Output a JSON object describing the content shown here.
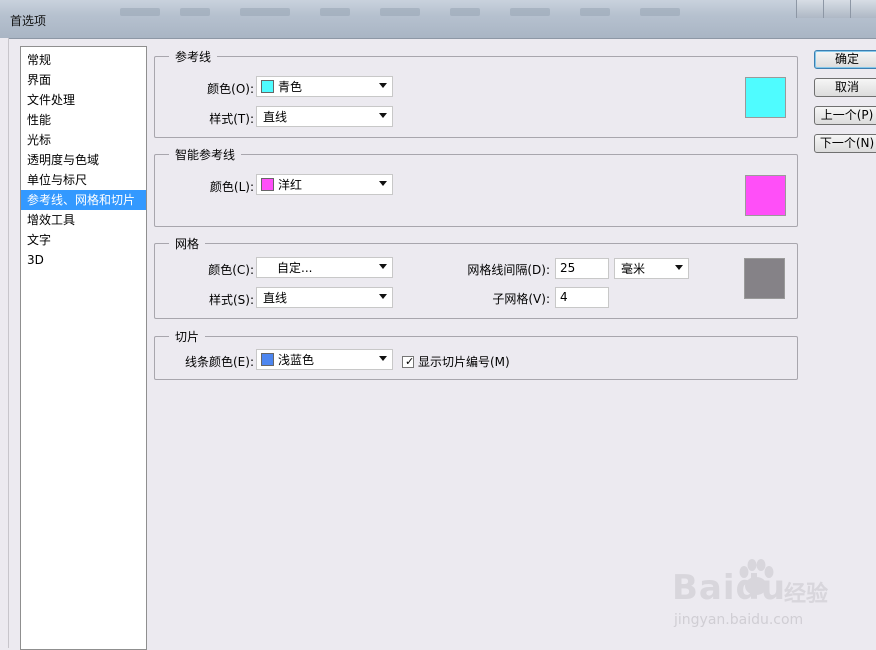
{
  "window": {
    "title": "首选项"
  },
  "sidebar": {
    "items": [
      {
        "label": "常规"
      },
      {
        "label": "界面"
      },
      {
        "label": "文件处理"
      },
      {
        "label": "性能"
      },
      {
        "label": "光标"
      },
      {
        "label": "透明度与色域"
      },
      {
        "label": "单位与标尺"
      },
      {
        "label": "参考线、网格和切片",
        "selected": true
      },
      {
        "label": "增效工具"
      },
      {
        "label": "文字"
      },
      {
        "label": "3D"
      }
    ]
  },
  "guides": {
    "legend": "参考线",
    "color_label": "颜色(O):",
    "color_value": "青色",
    "color_hex": "#4ffcff",
    "style_label": "样式(T):",
    "style_value": "直线"
  },
  "smart_guides": {
    "legend": "智能参考线",
    "color_label": "颜色(L):",
    "color_value": "洋红",
    "color_hex": "#ff4ff8"
  },
  "grid": {
    "legend": "网格",
    "color_label": "颜色(C):",
    "color_value": "自定...",
    "color_hex": "#858287",
    "style_label": "样式(S):",
    "style_value": "直线",
    "spacing_label": "网格线间隔(D):",
    "spacing_value": "25",
    "unit_value": "毫米",
    "subdiv_label": "子网格(V):",
    "subdiv_value": "4"
  },
  "slices": {
    "legend": "切片",
    "line_color_label": "线条颜色(E):",
    "line_color_value": "浅蓝色",
    "line_color_hex": "#4d86f0",
    "show_numbers_label": "显示切片编号(M)",
    "show_numbers_checked": true
  },
  "buttons": {
    "ok": "确定",
    "cancel": "取消",
    "prev": "上一个(P)",
    "next": "下一个(N)"
  },
  "watermark": {
    "brand": "Baidu",
    "cn": "经验",
    "url": "jingyan.baidu.com"
  }
}
